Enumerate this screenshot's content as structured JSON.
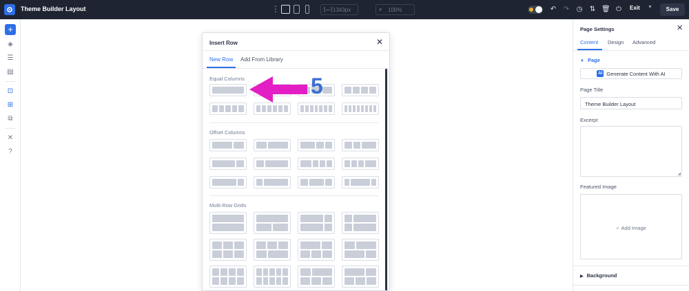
{
  "topbar": {
    "title": "Theme Builder Layout",
    "width_value": "1343px",
    "zoom_value": "100%",
    "exit_label": "Exit",
    "save_label": "Save"
  },
  "modal": {
    "title": "Insert Row",
    "tabs": [
      "New Row",
      "Add From Library"
    ],
    "sections": {
      "equal": "Equal Columns",
      "offset": "Offset Columns",
      "multi": "Multi-Row Grids"
    }
  },
  "annotation": {
    "number": "5",
    "color": "#e31ec4"
  },
  "right_panel": {
    "title": "Page Settings",
    "tabs": [
      "Content",
      "Design",
      "Advanced"
    ],
    "section_page": "Page",
    "generate_button": "Generate Content With AI",
    "ai_badge": "AI",
    "page_title_label": "Page Title",
    "page_title_value": "Theme Builder Layout",
    "excerpt_label": "Excerpt",
    "featured_image_label": "Featured Image",
    "add_image_label": "Add Image",
    "section_background": "Background"
  },
  "colors": {
    "accent": "#2e6fe8",
    "topbar_bg": "#1e2431",
    "annotation": "#e31ec4"
  }
}
